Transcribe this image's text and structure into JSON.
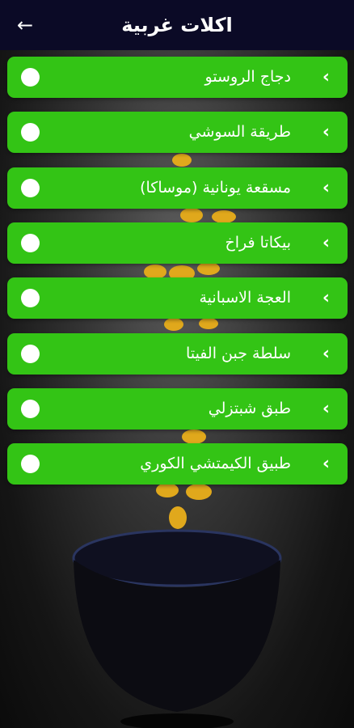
{
  "header": {
    "title": "اكلات غربية",
    "back_icon": "arrow-left-icon"
  },
  "items": [
    {
      "label": "دجاج الروستو"
    },
    {
      "label": "طريقة السوشي"
    },
    {
      "label": "مسقعة يونانية (موساكا)"
    },
    {
      "label": "بيكاتا فراخ"
    },
    {
      "label": "العجة الاسبانية"
    },
    {
      "label": "سلطة جبن الفيتا"
    },
    {
      "label": "طبق شبتزلي"
    },
    {
      "label": "طبيق الكيمتشي الكوري"
    }
  ],
  "colors": {
    "header_bg": "#0b0a26",
    "item_bg": "#33c415",
    "text": "#ffffff"
  }
}
